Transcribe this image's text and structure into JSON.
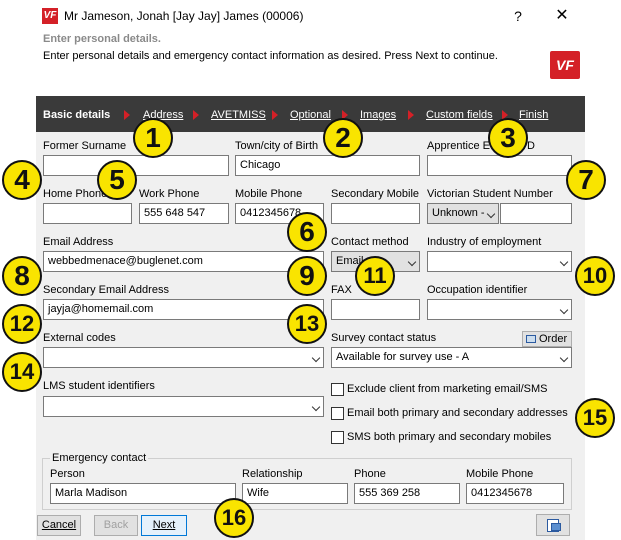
{
  "window": {
    "title": "Mr Jameson, Jonah [Jay Jay] James (00006)",
    "logo": "VF",
    "help": "?",
    "close": "✕"
  },
  "header": {
    "title": "Enter personal details.",
    "subtitle": "Enter personal details and emergency contact information as desired.  Press Next to continue.",
    "logo": "VF"
  },
  "nav": {
    "items": [
      "Basic details",
      "Address",
      "AVETMISS",
      "Optional",
      "Images",
      "Custom fields",
      "Finish"
    ]
  },
  "form": {
    "former_surname": {
      "label": "Former Surname",
      "value": ""
    },
    "town_of_birth": {
      "label": "Town/city of Birth",
      "value": "Chicago"
    },
    "apprentice": {
      "label": "Apprentice E",
      "label_end": "D",
      "value": ""
    },
    "home_phone": {
      "label": "Home Phone",
      "value": ""
    },
    "work_phone": {
      "label": "Work Phone",
      "value": "555 648 547"
    },
    "mobile_phone": {
      "label": "Mobile Phone",
      "value": "0412345678"
    },
    "secondary_mobile": {
      "label": "Secondary Mobile",
      "value": ""
    },
    "victorian_student_number": {
      "label": "Victorian Student Number",
      "select": "Unknown -",
      "value": ""
    },
    "email": {
      "label": "Email Address",
      "value": "webbedmenace@buglenet.com"
    },
    "contact_method": {
      "label": "Contact method",
      "value": "Email"
    },
    "industry": {
      "label": "Industry of employment",
      "value": ""
    },
    "secondary_email": {
      "label": "Secondary Email Address",
      "value": "jayja@homemail.com"
    },
    "fax": {
      "label": "FAX",
      "value": ""
    },
    "occupation": {
      "label": "Occupation identifier",
      "value": ""
    },
    "external_codes": {
      "label": "External codes",
      "value": ""
    },
    "survey_status": {
      "label": "Survey contact status",
      "value": "Available for survey use - A",
      "order_label": "Order"
    },
    "lms_ids": {
      "label": "LMS student identifiers",
      "value": ""
    },
    "checkboxes": [
      {
        "label": "Exclude client from marketing email/SMS",
        "checked": false
      },
      {
        "label": "Email both primary and secondary addresses",
        "checked": false
      },
      {
        "label": "SMS both primary and secondary mobiles",
        "checked": false
      }
    ]
  },
  "emergency": {
    "legend": "Emergency contact",
    "person": {
      "label": "Person",
      "value": "Marla Madison"
    },
    "relationship": {
      "label": "Relationship",
      "value": "Wife"
    },
    "phone": {
      "label": "Phone",
      "value": "555 369 258"
    },
    "mobile": {
      "label": "Mobile Phone",
      "value": "0412345678"
    }
  },
  "buttons": {
    "cancel": "Cancel",
    "back": "Back",
    "next": "Next"
  },
  "callouts": [
    "1",
    "2",
    "3",
    "4",
    "5",
    "6",
    "7",
    "8",
    "9",
    "10",
    "11",
    "12",
    "13",
    "14",
    "15",
    "16"
  ],
  "colors": {
    "accent": "#d42027",
    "nav_bg": "#3a3a3a",
    "callout": "#f9e400"
  }
}
